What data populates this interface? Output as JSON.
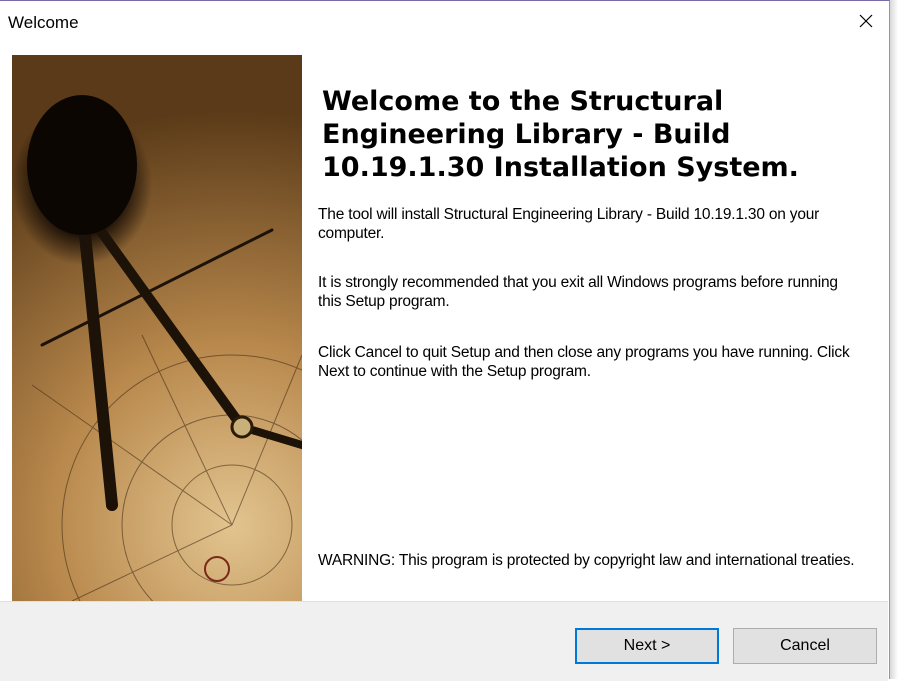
{
  "window": {
    "title": "Welcome",
    "close_icon": "close-icon"
  },
  "main": {
    "heading": "Welcome to the Structural Engineering Library - Build 10.19.1.30 Installation System.",
    "paragraph1": "The tool will install Structural Engineering Library - Build 10.19.1.30 on your computer.",
    "paragraph2": "It is strongly recommended that you exit all Windows programs before running this Setup program.",
    "paragraph3": "Click Cancel to quit Setup and then close any programs you have running. Click Next to continue with the Setup program.",
    "warning": "WARNING: This program is protected by copyright law and international treaties."
  },
  "buttons": {
    "next_label": "Next >",
    "cancel_label": "Cancel"
  },
  "colors": {
    "accent": "#0078d7",
    "button_bar": "#f0f0f0"
  }
}
